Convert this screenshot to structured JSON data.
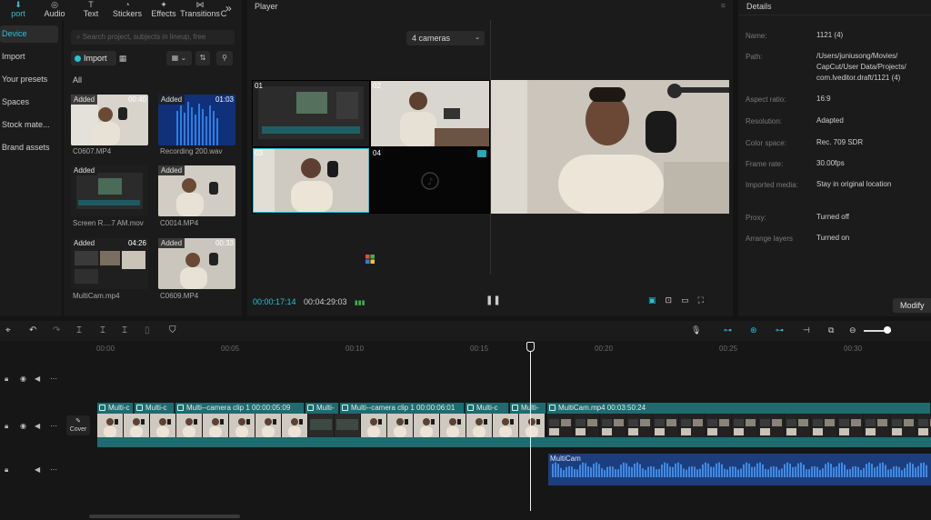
{
  "toolbar": {
    "tools": [
      "port",
      "Audio",
      "Text",
      "Stickers",
      "Effects",
      "Transitions",
      "C"
    ],
    "more": "»"
  },
  "sidenav": {
    "items": [
      "Device",
      "Import",
      "Your presets",
      "Spaces",
      "Stock mate...",
      "Brand assets"
    ]
  },
  "media": {
    "search_placeholder": "Search project, subjects in lineup, free",
    "import_label": "Import",
    "all_label": "All",
    "tiles": [
      {
        "badge": "Added",
        "duration": "00:40",
        "name": "C0607.MP4"
      },
      {
        "badge": "Added",
        "duration": "01:03",
        "name": "Recording 200.wav"
      },
      {
        "badge": "Added",
        "duration": "",
        "name": "Screen R....7 AM.mov"
      },
      {
        "badge": "Added",
        "duration": "",
        "name": "C0014.MP4"
      },
      {
        "badge": "Added",
        "duration": "04:26",
        "name": "MultiCam.mp4"
      },
      {
        "badge": "Added",
        "duration": "00:33",
        "name": "C0609.MP4"
      }
    ]
  },
  "player": {
    "title": "Player",
    "menu": "≡",
    "camera_select": "4 cameras",
    "cameras": [
      "01",
      "02",
      "03",
      "04"
    ],
    "current_time": "00:00:17:14",
    "total_time": "00:04:29:03",
    "pause": "❚❚",
    "accent": "#27c3d6"
  },
  "details": {
    "title": "Details",
    "rows": [
      {
        "label": "Name:",
        "value": "1121 (4)"
      },
      {
        "label": "Path:",
        "value": "/Users/juniusong/Movies/\nCapCut/User Data/Projects/\ncom.lveditor.draft/1121 (4)"
      },
      {
        "label": "Aspect ratio:",
        "value": "16:9"
      },
      {
        "label": "Resolution:",
        "value": "Adapted"
      },
      {
        "label": "Color space:",
        "value": "Rec. 709 SDR"
      },
      {
        "label": "Frame rate:",
        "value": "30.00fps"
      },
      {
        "label": "Imported media:",
        "value": "Stay in original location"
      },
      {
        "label": "Proxy:",
        "value": "Turned off"
      },
      {
        "label": "Arrange layers",
        "value": "Turned on"
      }
    ],
    "modify_label": "Modify"
  },
  "timeline": {
    "ruler": [
      "00:00",
      "00:05",
      "00:10",
      "00:15",
      "00:20",
      "00:25",
      "00:30"
    ],
    "cover_label": "Cover",
    "clips": [
      {
        "label": "Multi-c"
      },
      {
        "label": "Multi-c"
      },
      {
        "label": "Multi--camera clip 1  00:00:05:09"
      },
      {
        "label": "Multi-"
      },
      {
        "label": "Multi--camera clip 1  00:00:06:01"
      },
      {
        "label": "Multi-c"
      },
      {
        "label": "Multi-"
      },
      {
        "label": "MultiCam.mp4  00:03:50:24"
      }
    ],
    "audio_label": "MultiCam"
  }
}
